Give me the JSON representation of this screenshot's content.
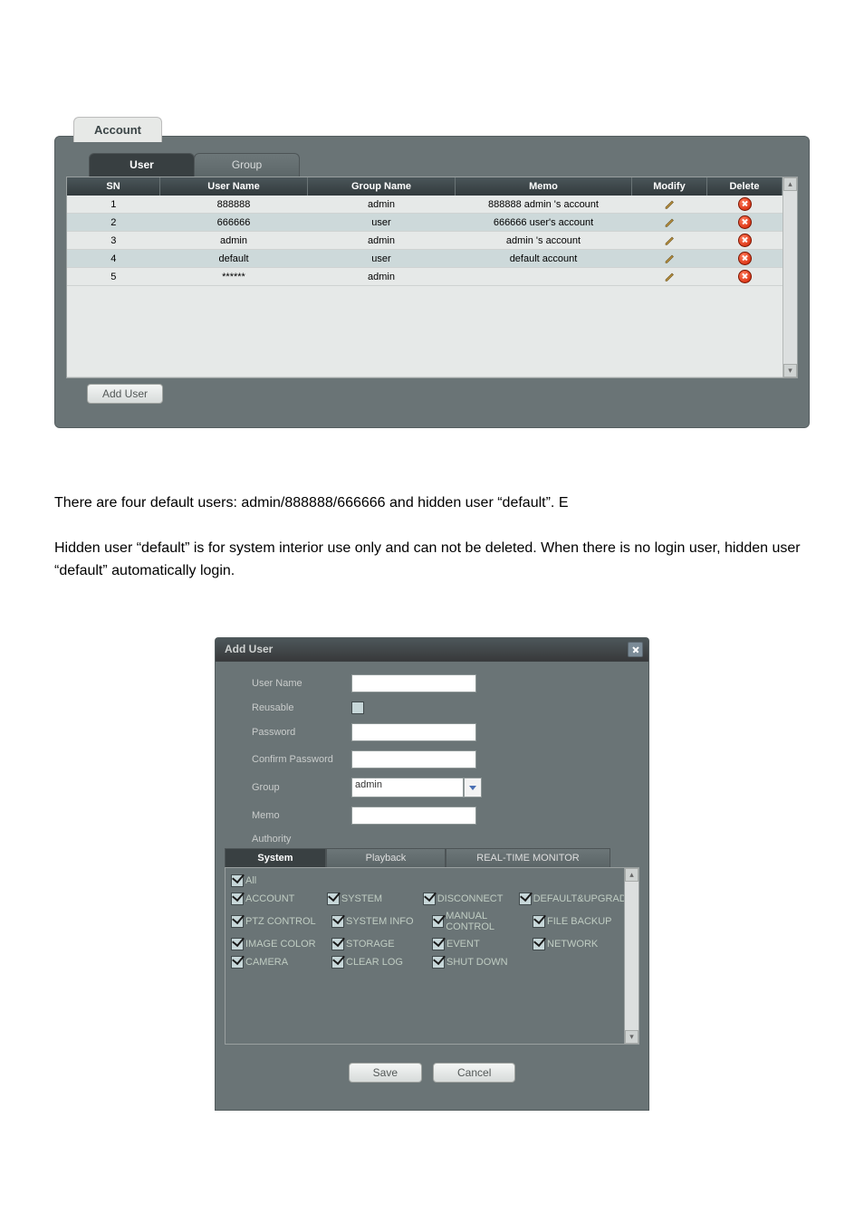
{
  "account_panel": {
    "title": "Account",
    "tabs": {
      "user": "User",
      "group": "Group",
      "active": "user"
    },
    "columns": {
      "sn": "SN",
      "user_name": "User Name",
      "group_name": "Group Name",
      "memo": "Memo",
      "modify": "Modify",
      "delete": "Delete"
    },
    "rows": [
      {
        "sn": "1",
        "user_name": "888888",
        "group_name": "admin",
        "memo": "888888 admin 's account",
        "alt": true
      },
      {
        "sn": "2",
        "user_name": "666666",
        "group_name": "user",
        "memo": "666666 user's account",
        "alt": false
      },
      {
        "sn": "3",
        "user_name": "admin",
        "group_name": "admin",
        "memo": "admin 's account",
        "alt": true
      },
      {
        "sn": "4",
        "user_name": "default",
        "group_name": "user",
        "memo": "default account",
        "alt": false
      },
      {
        "sn": "5",
        "user_name": "******",
        "group_name": "admin",
        "memo": "",
        "alt": true
      }
    ],
    "add_user_btn": "Add User"
  },
  "prose": {
    "p1": "There are four default users: admin/888888/666666 and hidden user “default”. E",
    "p2": "Hidden user “default” is for system interior use only and can not be deleted. When there is no login user, hidden user “default” automatically login."
  },
  "dialog": {
    "title": "Add User",
    "labels": {
      "user_name": "User Name",
      "reusable": "Reusable",
      "password": "Password",
      "confirm_password": "Confirm Password",
      "group": "Group",
      "memo": "Memo",
      "authority": "Authority"
    },
    "values": {
      "group": "admin",
      "reusable_checked": false
    },
    "auth_tabs": {
      "system": "System",
      "playback": "Playback",
      "realtime": "REAL-TIME MONITOR"
    },
    "perms": {
      "all": "All",
      "rows": [
        [
          "ACCOUNT",
          "SYSTEM",
          "DISCONNECT",
          "DEFAULT&UPGRADE"
        ],
        [
          "PTZ CONTROL",
          "SYSTEM INFO",
          "MANUAL CONTROL",
          "FILE BACKUP"
        ],
        [
          "IMAGE COLOR",
          "STORAGE",
          "EVENT",
          "NETWORK"
        ],
        [
          "CAMERA",
          "CLEAR LOG",
          "SHUT DOWN",
          ""
        ]
      ]
    },
    "buttons": {
      "save": "Save",
      "cancel": "Cancel"
    }
  }
}
